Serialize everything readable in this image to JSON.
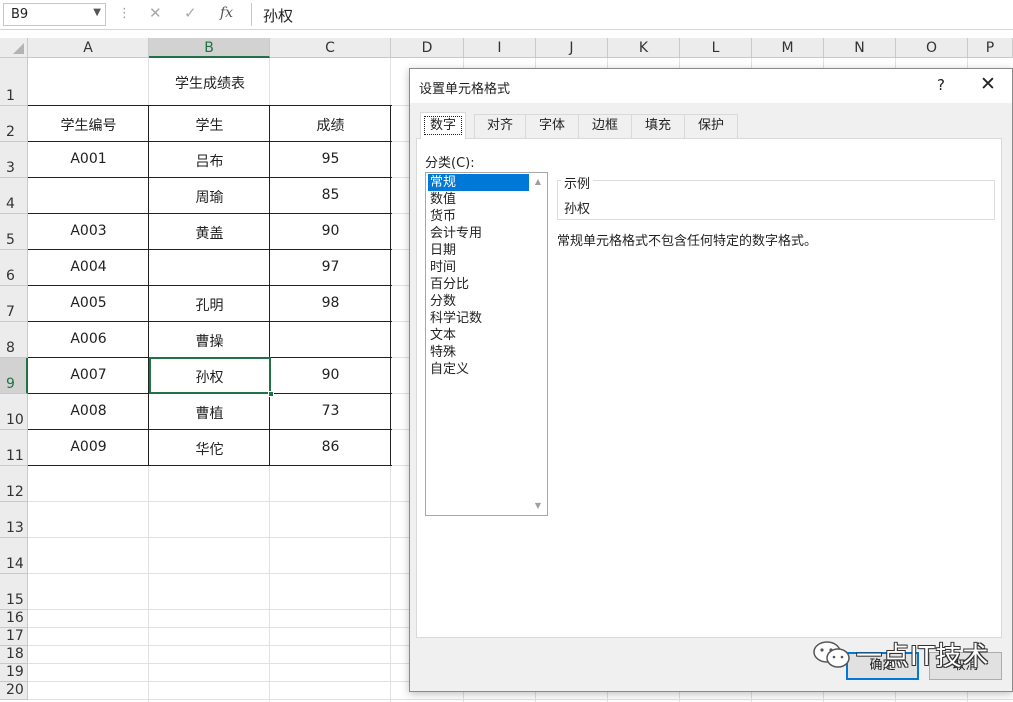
{
  "formula_bar": {
    "name_box": "B9",
    "formula": "孙权",
    "fx_label": "fx"
  },
  "columns": [
    "A",
    "B",
    "C",
    "D",
    "I",
    "J",
    "K",
    "L",
    "M",
    "N",
    "O",
    "P"
  ],
  "rows": [
    "1",
    "2",
    "3",
    "4",
    "5",
    "6",
    "7",
    "8",
    "9",
    "10",
    "11",
    "12",
    "13",
    "14",
    "15",
    "16",
    "17",
    "18",
    "19",
    "20"
  ],
  "sheet": {
    "title": "学生成绩表",
    "headers": [
      "学生编号",
      "学生",
      "成绩"
    ],
    "records": [
      [
        "A001",
        "吕布",
        "95"
      ],
      [
        "",
        "周瑜",
        "85"
      ],
      [
        "A003",
        "黄盖",
        "90"
      ],
      [
        "A004",
        "",
        "97"
      ],
      [
        "A005",
        "孔明",
        "98"
      ],
      [
        "A006",
        "曹操",
        ""
      ],
      [
        "A007",
        "孙权",
        "90"
      ],
      [
        "A008",
        "曹植",
        "73"
      ],
      [
        "A009",
        "华佗",
        "86"
      ]
    ]
  },
  "dialog": {
    "title": "设置单元格格式",
    "help": "?",
    "close": "✕",
    "tabs": [
      "数字",
      "对齐",
      "字体",
      "边框",
      "填充",
      "保护"
    ],
    "category_label": "分类(C):",
    "categories": [
      "常规",
      "数值",
      "货币",
      "会计专用",
      "日期",
      "时间",
      "百分比",
      "分数",
      "科学记数",
      "文本",
      "特殊",
      "自定义"
    ],
    "sample_label": "示例",
    "sample_value": "孙权",
    "description": "常规单元格格式不包含任何特定的数字格式。",
    "ok_label": "确定",
    "cancel_label": "取消"
  },
  "watermark": {
    "text": "一点IT技术"
  }
}
